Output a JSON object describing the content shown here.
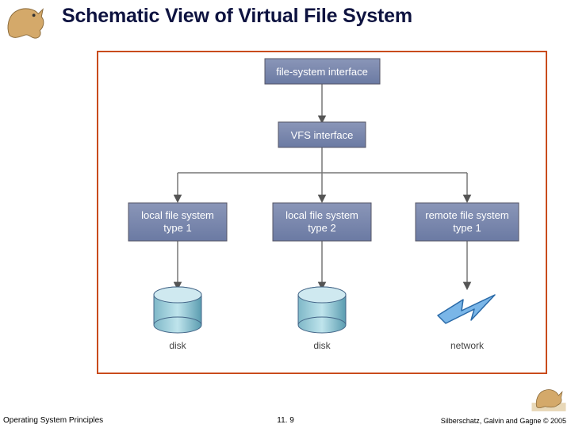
{
  "title": "Schematic View of Virtual File System",
  "boxes": {
    "top": "file-system interface",
    "mid": "VFS interface",
    "leaf1_l1": "local file system",
    "leaf1_l2": "type 1",
    "leaf2_l1": "local file system",
    "leaf2_l2": "type 2",
    "leaf3_l1": "remote file system",
    "leaf3_l2": "type 1"
  },
  "storage": {
    "disk1": "disk",
    "disk2": "disk",
    "net": "network"
  },
  "footer": {
    "left": "Operating System Principles",
    "center": "11. 9",
    "right": "Silberschatz, Galvin and Gagne © 2005"
  }
}
